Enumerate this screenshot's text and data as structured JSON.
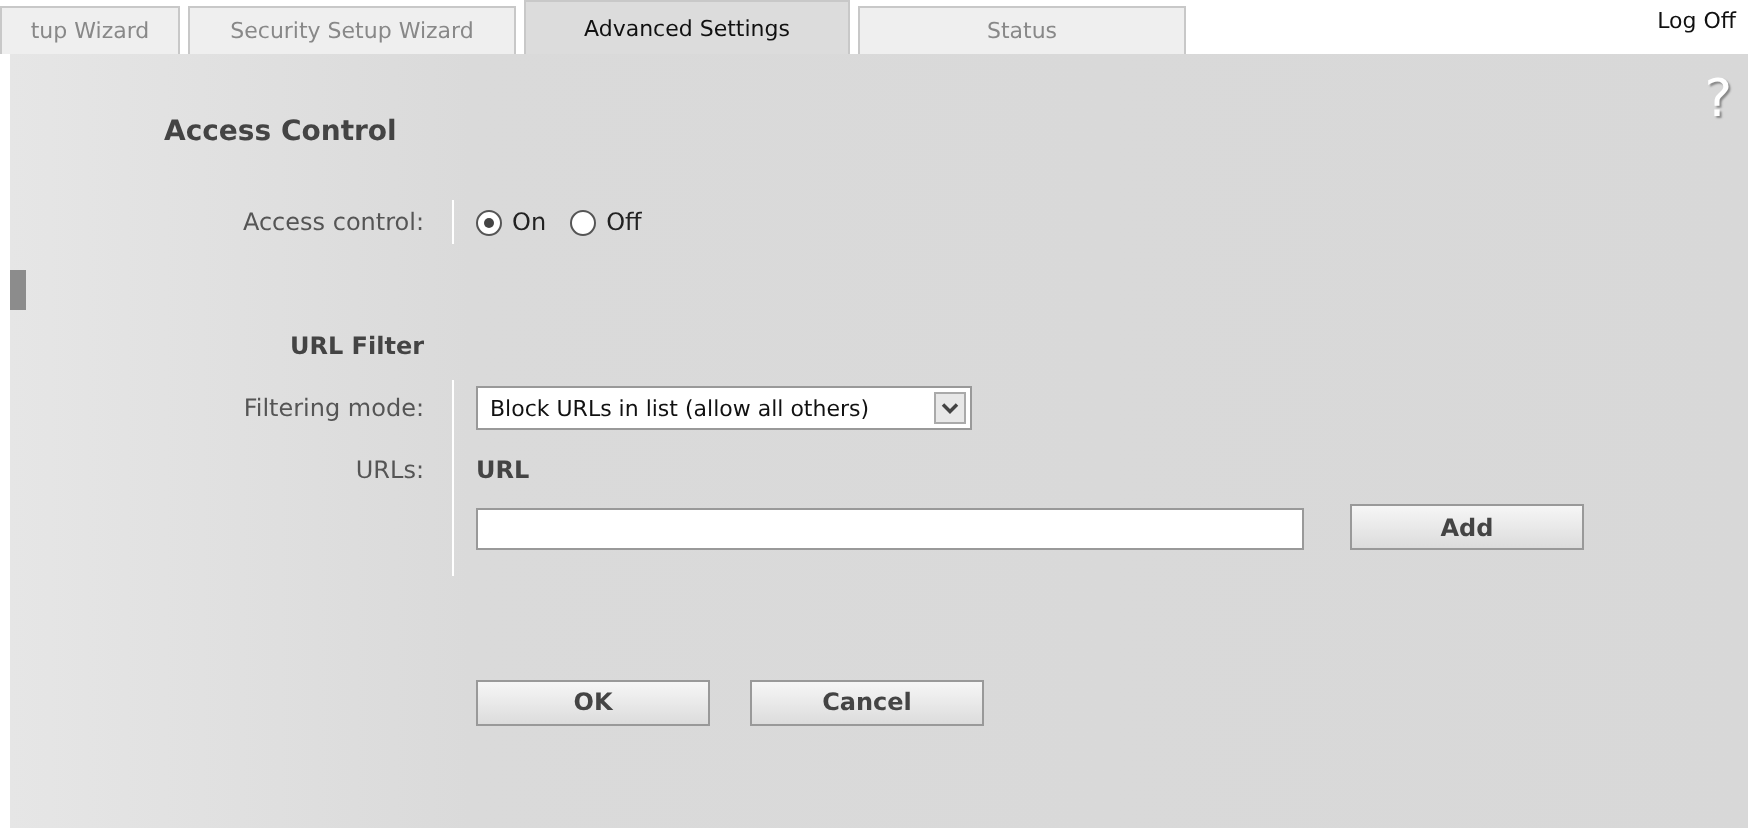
{
  "tabs": [
    {
      "label": "tup Wizard",
      "selected": false
    },
    {
      "label": "Security Setup Wizard",
      "selected": false
    },
    {
      "label": "Advanced Settings",
      "selected": true
    },
    {
      "label": "Status",
      "selected": false
    }
  ],
  "log_off": "Log Off",
  "help": "?",
  "title": "Access Control",
  "access_control": {
    "label": "Access control:",
    "options": [
      {
        "label": "On",
        "selected": true
      },
      {
        "label": "Off",
        "selected": false
      }
    ]
  },
  "section": "URL Filter",
  "filtering_mode": {
    "label": "Filtering mode:",
    "value": "Block URLs in list (allow all others)"
  },
  "urls": {
    "label": "URLs:",
    "column": "URL",
    "add": "Add"
  },
  "buttons": [
    "OK",
    "Cancel"
  ]
}
